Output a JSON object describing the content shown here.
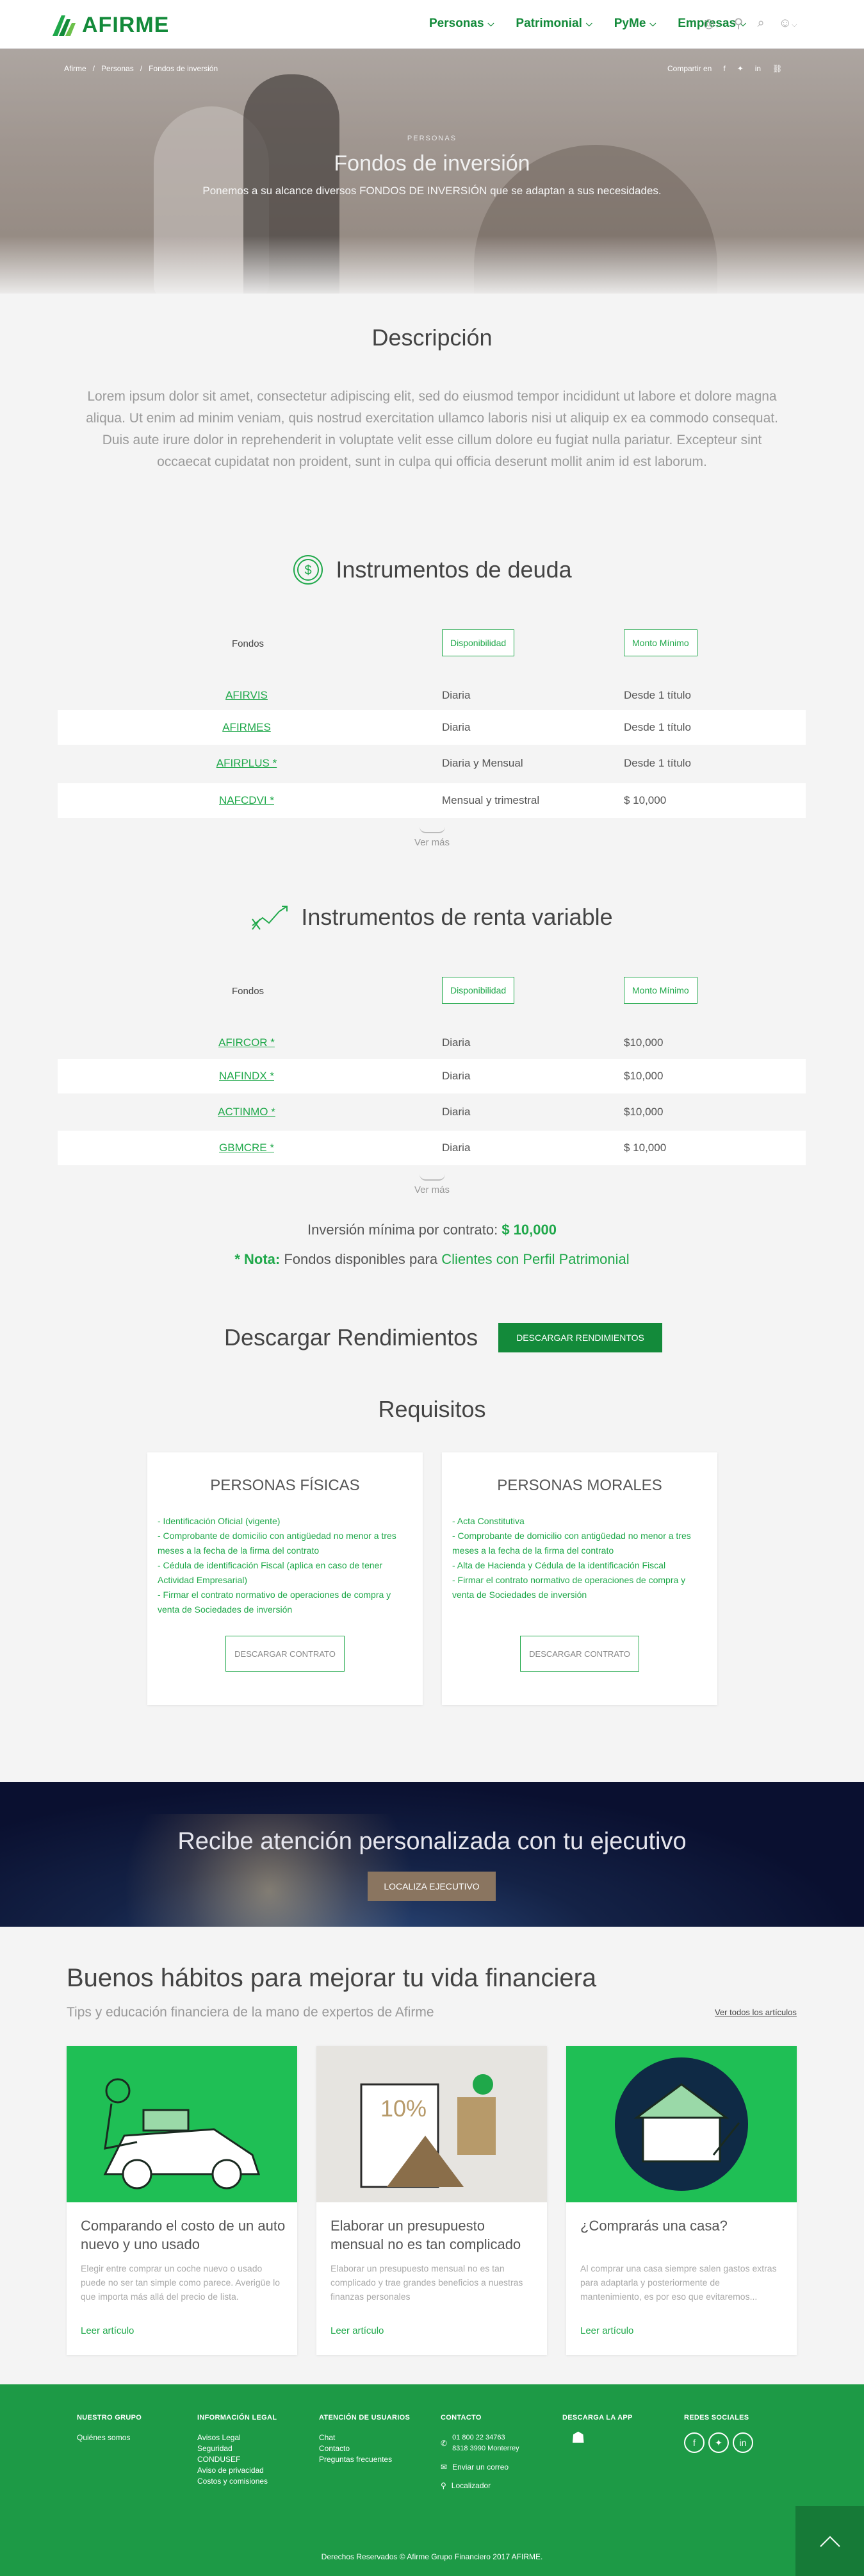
{
  "header": {
    "logo_text": "AFIRME",
    "nav": [
      {
        "label": "Personas"
      },
      {
        "label": "Patrimonial"
      },
      {
        "label": "PyMe"
      },
      {
        "label": "Empresas"
      }
    ]
  },
  "hero": {
    "breadcrumb": [
      "Afirme",
      "Personas",
      "Fondos de inversión"
    ],
    "share_label": "Compartir en",
    "kicker": "PERSONAS",
    "title": "Fondos de inversión",
    "subtitle": "Ponemos a su alcance diversos FONDOS DE INVERSIÓN que se adaptan a sus necesidades."
  },
  "descripcion": {
    "title": "Descripción",
    "body": "Lorem ipsum dolor sit amet, consectetur adipiscing elit, sed do eiusmod tempor incididunt ut labore et dolore magna aliqua. Ut enim ad minim veniam, quis nostrud exercitation ullamco laboris nisi ut aliquip ex ea commodo consequat. Duis aute irure dolor in reprehenderit in voluptate velit esse cillum dolore eu fugiat nulla pariatur. Excepteur sint occaecat cupidatat non proident, sunt in culpa qui officia deserunt mollit anim id est laborum."
  },
  "deuda": {
    "title": "Instrumentos de deuda",
    "col_fondos": "Fondos",
    "col_disponibilidad": "Disponibilidad",
    "col_monto": "Monto Mínimo",
    "rows": [
      {
        "fondo": "AFIRVIS",
        "disp": "Diaria",
        "monto": "Desde 1 título"
      },
      {
        "fondo": "AFIRMES",
        "disp": "Diaria",
        "monto": "Desde 1 título"
      },
      {
        "fondo": "AFIRPLUS *",
        "disp": "Diaria y Mensual",
        "monto": "Desde 1 título"
      },
      {
        "fondo": "NAFCDVI *",
        "disp": "Mensual y trimestral",
        "monto": "$ 10,000"
      }
    ],
    "ver_mas": "Ver más"
  },
  "renta": {
    "title": "Instrumentos de renta variable",
    "col_fondos": "Fondos",
    "col_disponibilidad": "Disponibilidad",
    "col_monto": "Monto Mínimo",
    "rows": [
      {
        "fondo": "AFIRCOR *",
        "disp": "Diaria",
        "monto": "$10,000"
      },
      {
        "fondo": "NAFINDX *",
        "disp": "Diaria",
        "monto": "$10,000"
      },
      {
        "fondo": "ACTINMO *",
        "disp": "Diaria",
        "monto": "$10,000"
      },
      {
        "fondo": "GBMCRE *",
        "disp": "Diaria",
        "monto": "$ 10,000"
      }
    ],
    "ver_mas": "Ver más"
  },
  "minimo": {
    "label": "Inversión mínima por contrato:",
    "value": "$ 10,000"
  },
  "nota": {
    "label": "* Nota:",
    "text": "Fondos disponibles para",
    "link": "Clientes con Perfil Patrimonial"
  },
  "descargar": {
    "title": "Descargar Rendimientos",
    "button": "DESCARGAR RENDIMIENTOS"
  },
  "requisitos": {
    "title": "Requisitos",
    "fisicas": {
      "title": "PERSONAS FÍSICAS",
      "items": [
        "- Identificación Oficial (vigente)",
        "- Comprobante de domicilio con antigüedad no menor a tres meses a la fecha de la firma del contrato",
        "- Cédula de identificación Fiscal (aplica en caso de tener Actividad Empresarial)",
        "- Firmar el contrato normativo de operaciones de compra y venta de Sociedades de inversión"
      ],
      "button": "DESCARGAR CONTRATO"
    },
    "morales": {
      "title": "PERSONAS MORALES",
      "items": [
        "- Acta Constitutiva",
        "- Comprobante de domicilio con antigüedad no menor a tres meses a la fecha de la firma del contrato",
        "- Alta de Hacienda y Cédula de la identificación Fiscal",
        "- Firmar el contrato normativo de operaciones de compra y venta de Sociedades de inversión"
      ],
      "button": "DESCARGAR CONTRATO"
    }
  },
  "banner": {
    "title": "Recibe atención personalizada con tu ejecutivo",
    "button": "LOCALIZA EJECUTIVO"
  },
  "blog": {
    "title": "Buenos hábitos para mejorar tu vida financiera",
    "subtitle": "Tips y educación financiera de la mano de expertos de Afirme",
    "all_link": "Ver todos los artículos",
    "posts": [
      {
        "title": "Comparando el costo de un auto nuevo y uno usado",
        "excerpt": "Elegir entre comprar un coche nuevo o usado puede no ser tan simple como parece. Averigüe lo que importa más allá del precio de lista.",
        "link": "Leer artículo"
      },
      {
        "title": "Elaborar un presupuesto mensual no es tan complicado",
        "excerpt": "Elaborar un presupuesto mensual no es tan complicado y trae grandes beneficios a nuestras finanzas personales",
        "link": "Leer artículo"
      },
      {
        "title": "¿Comprarás una casa?",
        "excerpt": "Al comprar una casa siempre salen gastos extras para adaptarla y posteriormente de mantenimiento, es por eso que evitaremos...",
        "link": "Leer artículo"
      }
    ]
  },
  "footer": {
    "grupo": {
      "title": "NUESTRO GRUPO",
      "items": [
        "Quiénes somos"
      ]
    },
    "legal": {
      "title": "INFORMACIÓN LEGAL",
      "items": [
        "Avisos Legal",
        "Seguridad",
        "CONDUSEF",
        "Aviso de privacidad",
        "Costos y comisiones"
      ]
    },
    "atencion": {
      "title": "ATENCIÓN DE USUARIOS",
      "items": [
        "Chat",
        "Contacto",
        "Preguntas frecuentes"
      ]
    },
    "contacto": {
      "title": "CONTACTO",
      "phone1": "01 800 22 34763",
      "phone2": "8318 3990 Monterrey",
      "email": "Enviar un correo",
      "localizador": "Localizador"
    },
    "app": {
      "title": "DESCARGA LA APP"
    },
    "redes": {
      "title": "REDES SOCIALES"
    },
    "copyright": "Derechos Reservados © Afirme Grupo Financiero 2017 AFIRME."
  }
}
